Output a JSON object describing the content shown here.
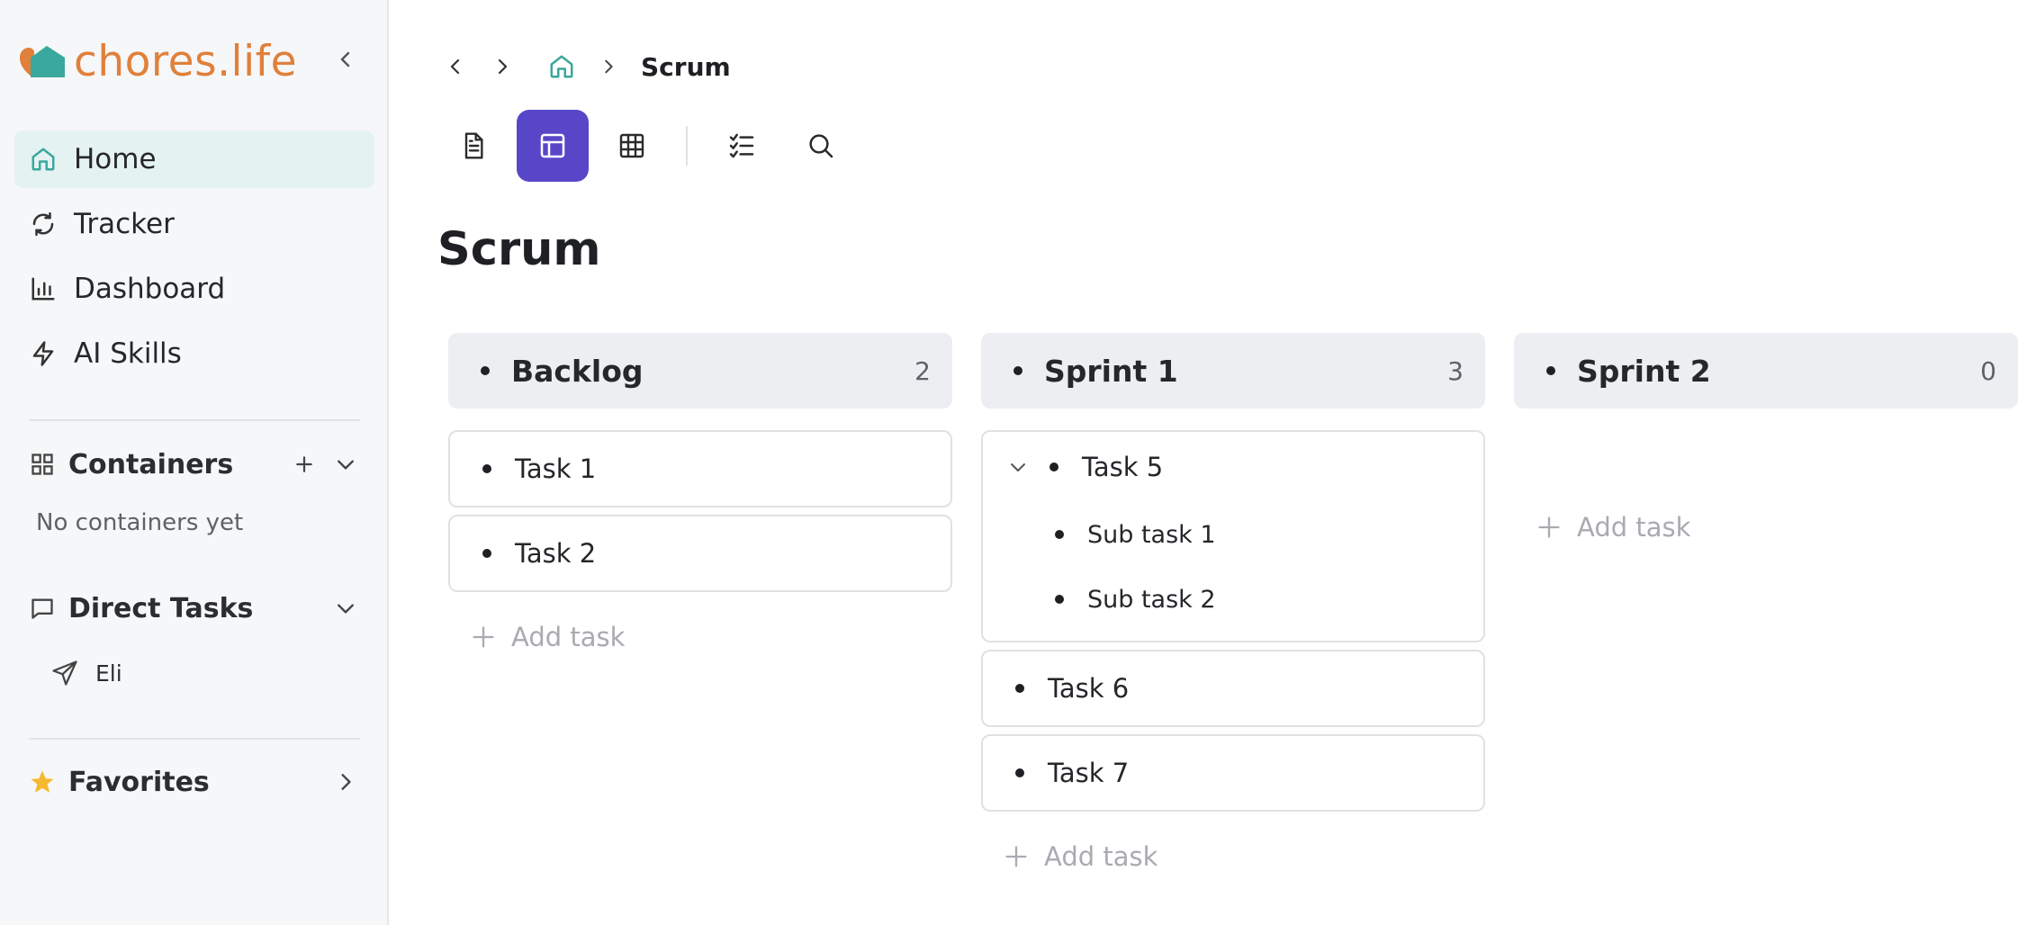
{
  "app": {
    "name": "chores.life",
    "colors": {
      "brand": "#e0803a",
      "accent": "#5747c8",
      "home_icon": "#3aa89d",
      "star": "#f5b92e"
    }
  },
  "sidebar": {
    "nav": [
      {
        "label": "Home",
        "icon": "home-icon",
        "active": true
      },
      {
        "label": "Tracker",
        "icon": "refresh-icon",
        "active": false
      },
      {
        "label": "Dashboard",
        "icon": "bar-chart-icon",
        "active": false
      },
      {
        "label": "AI Skills",
        "icon": "lightning-icon",
        "active": false
      }
    ],
    "containers": {
      "label": "Containers",
      "empty_text": "No containers yet"
    },
    "direct_tasks": {
      "label": "Direct Tasks",
      "items": [
        {
          "label": "Eli",
          "icon": "send-icon"
        }
      ]
    },
    "favorites": {
      "label": "Favorites"
    }
  },
  "breadcrumb": {
    "current": "Scrum"
  },
  "toolbar": {
    "views": [
      {
        "name": "document-view",
        "active": false
      },
      {
        "name": "board-view",
        "active": true
      },
      {
        "name": "table-view",
        "active": false
      },
      {
        "name": "checklist-view",
        "active": false
      },
      {
        "name": "search",
        "active": false
      }
    ]
  },
  "page": {
    "title": "Scrum"
  },
  "board": {
    "add_task_label": "Add task",
    "columns": [
      {
        "name": "Backlog",
        "count": "2",
        "tasks": [
          {
            "title": "Task 1"
          },
          {
            "title": "Task 2"
          }
        ]
      },
      {
        "name": "Sprint 1",
        "count": "3",
        "tasks": [
          {
            "title": "Task 5",
            "expanded": true,
            "subtasks": [
              "Sub task 1",
              "Sub task 2"
            ]
          },
          {
            "title": "Task 6"
          },
          {
            "title": "Task 7"
          }
        ]
      },
      {
        "name": "Sprint 2",
        "count": "0",
        "tasks": []
      }
    ]
  }
}
